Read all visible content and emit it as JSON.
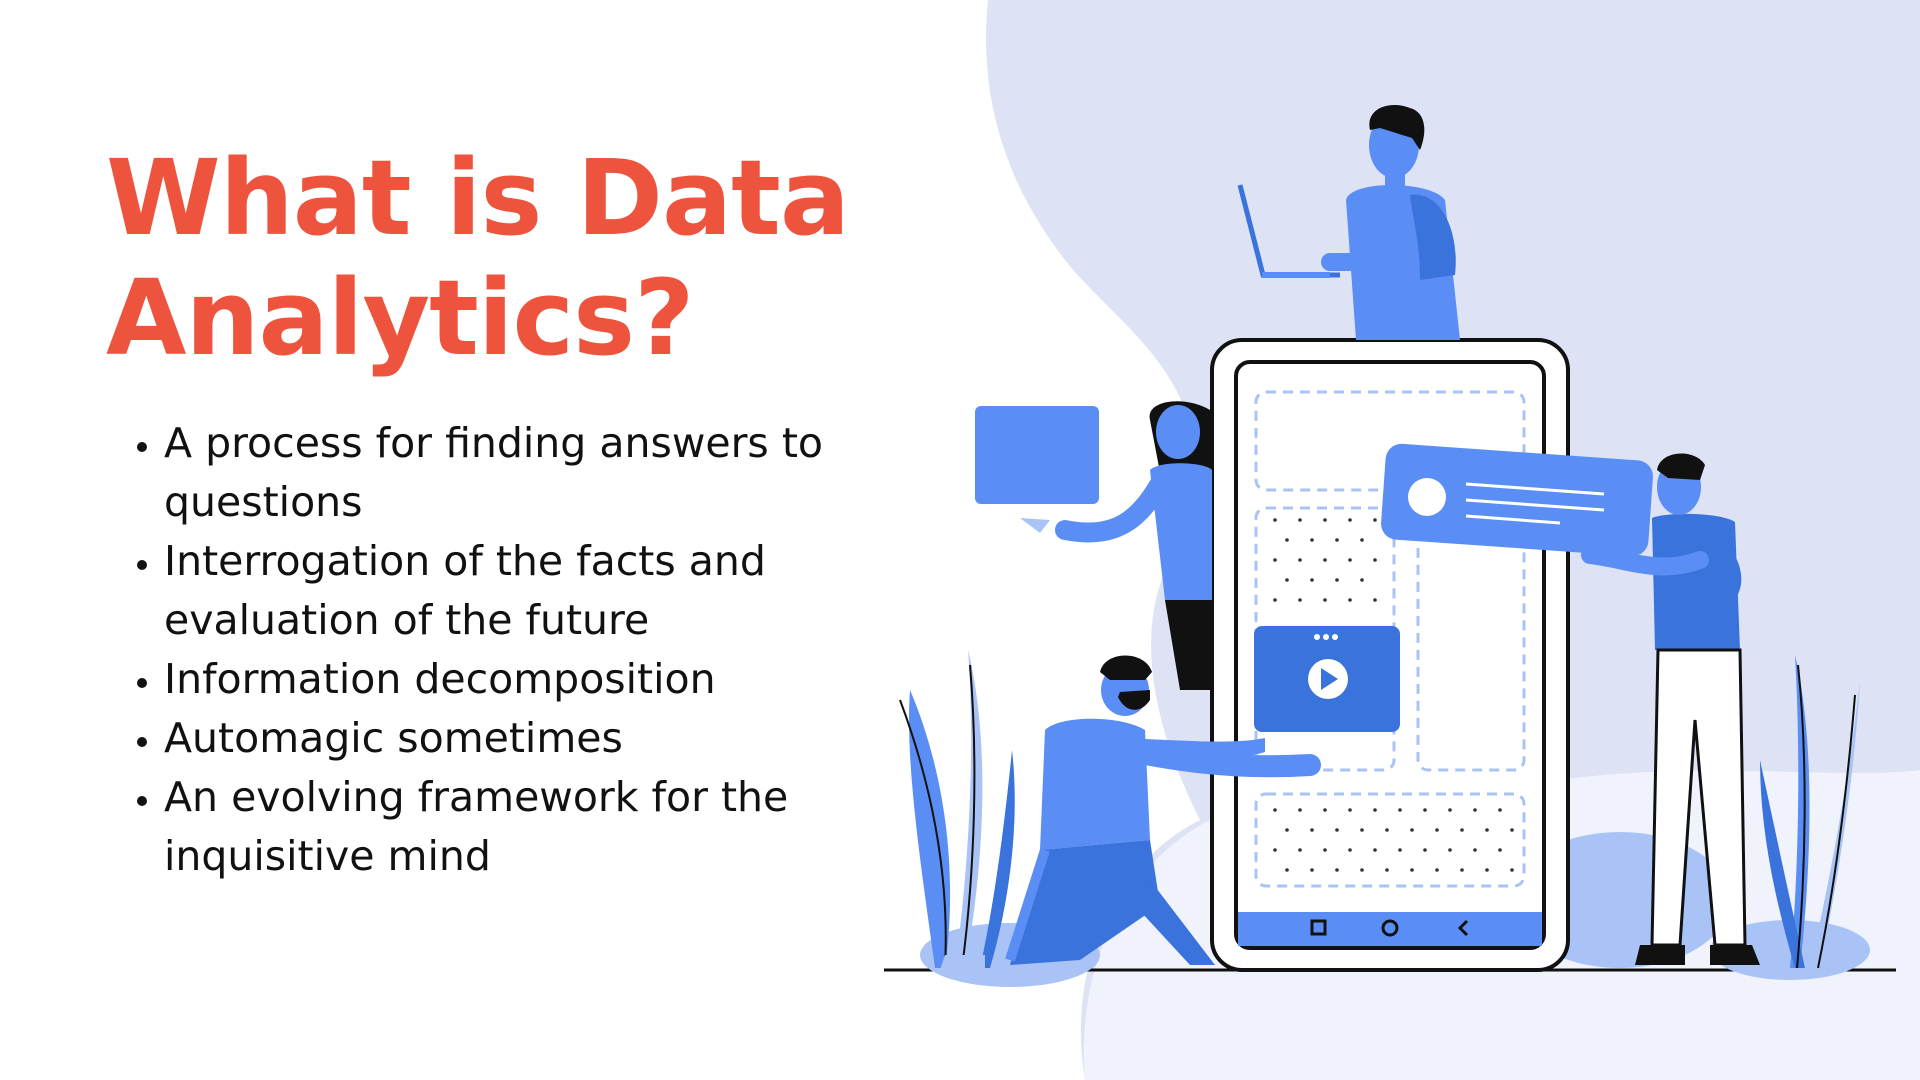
{
  "slide": {
    "title": "What is Data Analytics?",
    "bullets": [
      "A process for finding answers to questions",
      "Interrogation of the facts and evaluation of the future",
      "Information decomposition",
      "Automagic sometimes",
      "An evolving framework for the inquisitive mind"
    ]
  },
  "colors": {
    "title": "#ee543d",
    "text": "#111111",
    "blob": "#dde3f5",
    "accent_blue": "#5a8ef5",
    "dark_blue": "#3a73db",
    "light_blue": "#a9c3f7"
  },
  "illustration": {
    "description_icon": "people-around-phone-illustration",
    "icons": [
      "play-icon",
      "square-nav-icon",
      "circle-nav-icon",
      "back-nav-icon"
    ]
  }
}
